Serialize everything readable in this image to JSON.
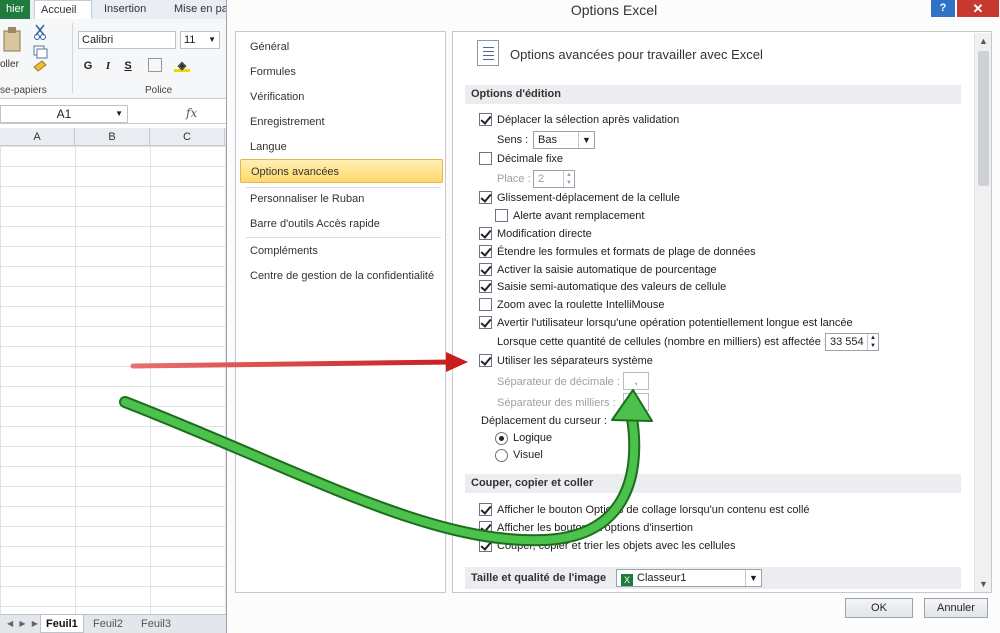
{
  "excel": {
    "tabs": {
      "fichier": "hier",
      "accueil": "Accueil",
      "insertion": "Insertion",
      "mise": "Mise en pa"
    },
    "ribbon": {
      "coller": "oller",
      "font": "Calibri",
      "size": "11",
      "bold": "G",
      "italic": "I",
      "underline": "S",
      "group_clipboard": "se-papiers",
      "group_police": "Police"
    },
    "namebox": "A1",
    "fx": "fx",
    "columns": [
      "A",
      "B",
      "C"
    ],
    "sheets": [
      "Feuil1",
      "Feuil2",
      "Feuil3"
    ]
  },
  "dialog": {
    "title": "Options Excel",
    "help": "?",
    "close": "✕",
    "nav": [
      "Général",
      "Formules",
      "Vérification",
      "Enregistrement",
      "Langue",
      "Options avancées",
      "Personnaliser le Ruban",
      "Barre d'outils Accès rapide",
      "Compléments",
      "Centre de gestion de la confidentialité"
    ],
    "selected_nav": "Options avancées",
    "header": "Options avancées pour travailler avec Excel",
    "sections": {
      "edition": "Options d'édition",
      "couper": "Couper, copier et coller",
      "taille": "Taille et qualité de l'image"
    },
    "options": {
      "deplacer": "Déplacer la sélection après validation",
      "sens_label": "Sens :",
      "sens_value": "Bas",
      "decimale_fixe": "Décimale fixe",
      "place_label": "Place :",
      "place_value": "2",
      "glissement": "Glissement-déplacement de la cellule",
      "alerte": "Alerte avant remplacement",
      "modification": "Modification directe",
      "etendre": "Étendre les formules et formats de plage de données",
      "activer": "Activer la saisie automatique de pourcentage",
      "saisie": "Saisie semi-automatique des valeurs de cellule",
      "zoom": "Zoom avec la roulette IntelliMouse",
      "avertir": "Avertir l'utilisateur lorsqu'une opération potentiellement longue est lancée",
      "quantite_label": "Lorsque cette quantité de cellules (nombre en milliers) est affectée :",
      "quantite_value": "33 554",
      "separateurs": "Utiliser les séparateurs système",
      "sep_decimale_label": "Séparateur de décimale :",
      "sep_decimale_value": ",",
      "sep_milliers_label": "Séparateur des milliers :",
      "deplacement_label": "Déplacement du curseur :",
      "logique": "Logique",
      "visuel": "Visuel",
      "afficher_collage": "Afficher le bouton Options de collage lorsqu'un contenu est collé",
      "afficher_insertion": "Afficher les boutons d'options d'insertion",
      "couper_copier": "Couper, copier et trier les objets avec les cellules",
      "classeur": "Classeur1"
    },
    "buttons": {
      "ok": "OK",
      "cancel": "Annuler"
    }
  },
  "colors": {
    "selected_nav": "#ffd86c",
    "annotation_red": "#c81e1e",
    "annotation_green": "#2e9b2e",
    "excel_green": "#1e7b3c"
  }
}
